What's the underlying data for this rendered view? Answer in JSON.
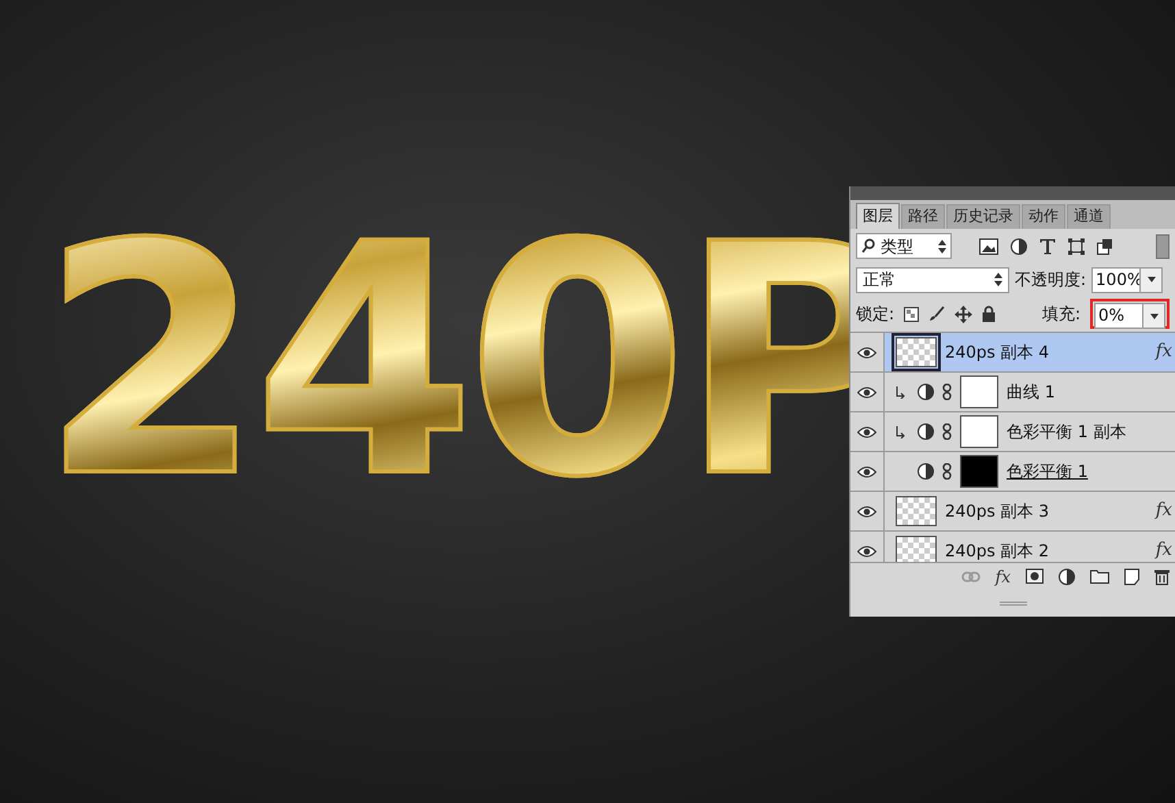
{
  "canvas": {
    "artwork_text": "240P"
  },
  "layers_panel": {
    "tabs": [
      {
        "label": "图层",
        "selected": true
      },
      {
        "label": "路径",
        "selected": false
      },
      {
        "label": "历史记录",
        "selected": false
      },
      {
        "label": "动作",
        "selected": false
      },
      {
        "label": "通道",
        "selected": false
      }
    ],
    "filter": {
      "value": "类型"
    },
    "blend_mode": {
      "value": "正常"
    },
    "opacity": {
      "label": "不透明度:",
      "value": "100%"
    },
    "lock": {
      "label": "锁定:"
    },
    "fill": {
      "label": "填充:",
      "value": "0%",
      "highlighted": true
    },
    "bottom_bar": {
      "effects_label": "fx"
    },
    "layers": [
      {
        "kind": "pixel",
        "name": "240ps 副本 4",
        "visible": true,
        "selected": true,
        "fx": "fx"
      },
      {
        "kind": "adjustment",
        "name": "曲线 1",
        "visible": true,
        "selected": false,
        "clipped": true,
        "mask_black": false
      },
      {
        "kind": "adjustment",
        "name": "色彩平衡 1 副本",
        "visible": true,
        "selected": false,
        "clipped": true,
        "mask_black": false
      },
      {
        "kind": "adjustment",
        "name": "色彩平衡 1",
        "visible": true,
        "selected": false,
        "clipped": false,
        "mask_black": true,
        "underlined": true
      },
      {
        "kind": "pixel",
        "name": "240ps 副本 3",
        "visible": true,
        "selected": false,
        "fx": "fx"
      },
      {
        "kind": "pixel",
        "name": "240ps 副本 2",
        "visible": true,
        "selected": false,
        "fx": "fx"
      }
    ]
  }
}
